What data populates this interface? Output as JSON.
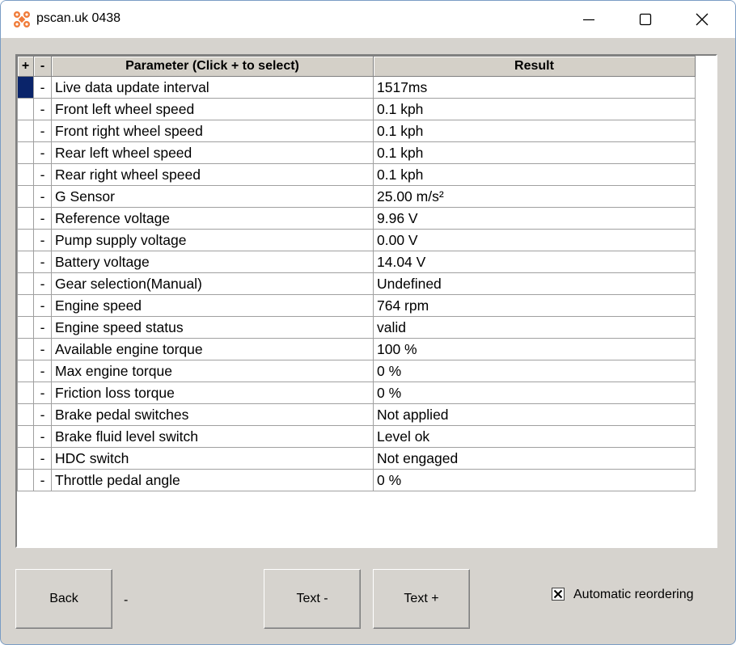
{
  "window": {
    "title": "pscan.uk 0438",
    "icon": "app-logo-icon"
  },
  "table": {
    "headers": {
      "plus": "+",
      "minus": "-",
      "parameter": "Parameter (Click + to select)",
      "result": "Result"
    },
    "rows": [
      {
        "minus": "-",
        "parameter": "Live data update interval",
        "result": "1517ms"
      },
      {
        "minus": "-",
        "parameter": "Front left wheel speed",
        "result": "0.1 kph"
      },
      {
        "minus": "-",
        "parameter": "Front right wheel speed",
        "result": "0.1 kph"
      },
      {
        "minus": "-",
        "parameter": "Rear left wheel speed",
        "result": "0.1 kph"
      },
      {
        "minus": "-",
        "parameter": "Rear right wheel speed",
        "result": "0.1 kph"
      },
      {
        "minus": "-",
        "parameter": "G Sensor",
        "result": "25.00 m/s²"
      },
      {
        "minus": "-",
        "parameter": "Reference voltage",
        "result": "9.96 V"
      },
      {
        "minus": "-",
        "parameter": "Pump supply voltage",
        "result": "0.00 V"
      },
      {
        "minus": "-",
        "parameter": "Battery voltage",
        "result": "14.04 V"
      },
      {
        "minus": "-",
        "parameter": "Gear selection(Manual)",
        "result": "Undefined"
      },
      {
        "minus": "-",
        "parameter": "Engine speed",
        "result": "764 rpm"
      },
      {
        "minus": "-",
        "parameter": "Engine speed status",
        "result": "valid"
      },
      {
        "minus": "-",
        "parameter": "Available engine torque",
        "result": "100 %"
      },
      {
        "minus": "-",
        "parameter": "Max engine torque",
        "result": "0 %"
      },
      {
        "minus": "-",
        "parameter": "Friction loss torque",
        "result": "0 %"
      },
      {
        "minus": "-",
        "parameter": "Brake pedal switches",
        "result": "Not applied"
      },
      {
        "minus": "-",
        "parameter": "Brake fluid level switch",
        "result": "Level ok"
      },
      {
        "minus": "-",
        "parameter": "HDC switch",
        "result": "Not engaged"
      },
      {
        "minus": "-",
        "parameter": "Throttle pedal angle",
        "result": "0 %"
      }
    ]
  },
  "buttons": {
    "back": "Back",
    "text_minus": "Text -",
    "text_plus": "Text +"
  },
  "status_label": "-",
  "auto_reorder": {
    "label": "Automatic reordering",
    "checked": true
  },
  "colors": {
    "selection": "#0a246a",
    "face": "#d6d3ce",
    "logo": "#f07c3a"
  }
}
